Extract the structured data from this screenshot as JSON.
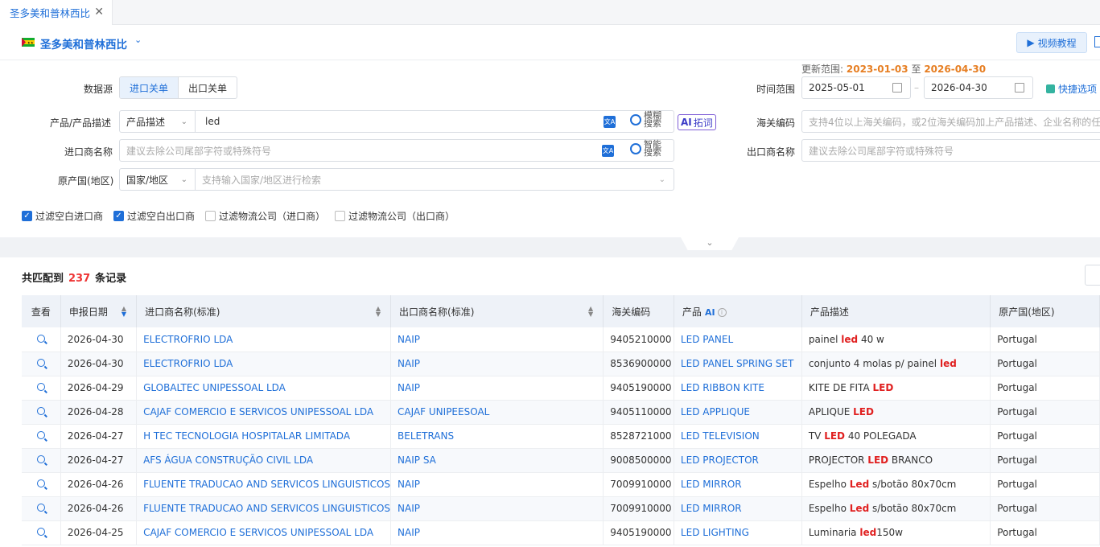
{
  "tabs": [
    {
      "label": "圣多美和普林西比",
      "close": "✕"
    }
  ],
  "header": {
    "country": "圣多美和普林西比",
    "video_btn": "视频教程"
  },
  "update_range": {
    "prefix": "更新范围:",
    "start": "2023-01-03",
    "sep": "至",
    "end": "2026-04-30"
  },
  "form": {
    "datasource_label": "数据源",
    "datasource_options": [
      "进口关单",
      "出口关单"
    ],
    "product_label": "产品/产品描述",
    "product_type": "产品描述",
    "product_value": "led",
    "fuzzy_search": "模糊搜索",
    "ai_expand": "拓词",
    "ai_prefix": "AI",
    "importer_label": "进口商名称",
    "importer_placeholder": "建议去除公司尾部字符或特殊符号",
    "smart_search": "智能搜索",
    "origin_label": "原产国(地区)",
    "origin_type": "国家/地区",
    "origin_placeholder": "支持输入国家/地区进行检索",
    "time_label": "时间范围",
    "time_start": "2025-05-01",
    "time_end": "2026-04-30",
    "time_sep": "–",
    "quick_select": "快捷选项",
    "hs_label": "海关编码",
    "hs_placeholder": "支持4位以上海关编码，或2位海关编码加上产品描述、企业名称的任",
    "exporter_label": "出口商名称",
    "exporter_placeholder": "建议去除公司尾部字符或特殊符号",
    "trans_icon": "文A"
  },
  "filters": [
    {
      "label": "过滤空白进口商",
      "checked": true
    },
    {
      "label": "过滤空白出口商",
      "checked": true
    },
    {
      "label": "过滤物流公司（进口商）",
      "checked": false
    },
    {
      "label": "过滤物流公司（出口商）",
      "checked": false
    }
  ],
  "summary": {
    "prefix": "共匹配到",
    "count": "237",
    "suffix": "条记录"
  },
  "table": {
    "columns": [
      "查看",
      "申报日期",
      "进口商名称(标准)",
      "出口商名称(标准)",
      "海关编码",
      "产品",
      "产品描述",
      "原产国(地区)"
    ],
    "product_ai": "AI",
    "rows": [
      {
        "date": "2026-04-30",
        "importer": "ELECTROFRIO LDA",
        "exporter": "NAIP",
        "hs": "9405210000",
        "product": "LED PANEL",
        "desc_pre": "painel ",
        "desc_kw": "led",
        "desc_post": " 40 w",
        "origin": "Portugal"
      },
      {
        "date": "2026-04-30",
        "importer": "ELECTROFRIO LDA",
        "exporter": "NAIP",
        "hs": "8536900000",
        "product": "LED PANEL SPRING SET",
        "desc_pre": "conjunto 4 molas p/ painel ",
        "desc_kw": "led",
        "desc_post": "",
        "origin": "Portugal"
      },
      {
        "date": "2026-04-29",
        "importer": "GLOBALTEC UNIPESSOAL LDA",
        "exporter": "NAIP",
        "hs": "9405190000",
        "product": "LED RIBBON KITE",
        "desc_pre": "KITE DE FITA ",
        "desc_kw": "LED",
        "desc_post": "",
        "origin": "Portugal"
      },
      {
        "date": "2026-04-28",
        "importer": "CAJAF COMERCIO E SERVICOS UNIPESSOAL LDA",
        "exporter": "CAJAF UNIPEESOAL",
        "hs": "9405110000",
        "product": "LED APPLIQUE",
        "desc_pre": "APLIQUE ",
        "desc_kw": "LED",
        "desc_post": "",
        "origin": "Portugal"
      },
      {
        "date": "2026-04-27",
        "importer": "H TEC TECNOLOGIA HOSPITALAR LIMITADA",
        "exporter": "BELETRANS",
        "hs": "8528721000",
        "product": "LED TELEVISION",
        "desc_pre": "TV ",
        "desc_kw": "LED",
        "desc_post": " 40 POLEGADA",
        "origin": "Portugal"
      },
      {
        "date": "2026-04-27",
        "importer": "AFS ÁGUA CONSTRUÇÃO CIVIL LDA",
        "exporter": "NAIP SA",
        "hs": "9008500000",
        "product": "LED PROJECTOR",
        "desc_pre": "PROJECTOR ",
        "desc_kw": "LED",
        "desc_post": " BRANCO",
        "origin": "Portugal"
      },
      {
        "date": "2026-04-26",
        "importer": "FLUENTE TRADUCAO AND SERVICOS LINGUISTICOS",
        "exporter": "NAIP",
        "hs": "7009910000",
        "product": "LED MIRROR",
        "desc_pre": "Espelho ",
        "desc_kw": "Led",
        "desc_post": " s/botão 80x70cm",
        "origin": "Portugal"
      },
      {
        "date": "2026-04-26",
        "importer": "FLUENTE TRADUCAO AND SERVICOS LINGUISTICOS",
        "exporter": "NAIP",
        "hs": "7009910000",
        "product": "LED MIRROR",
        "desc_pre": "Espelho ",
        "desc_kw": "Led",
        "desc_post": " s/botão 80x70cm",
        "origin": "Portugal"
      },
      {
        "date": "2026-04-25",
        "importer": "CAJAF COMERCIO E SERVICOS UNIPESSOAL LDA",
        "exporter": "NAIP",
        "hs": "9405190000",
        "product": "LED LIGHTING",
        "desc_pre": "Luminaria ",
        "desc_kw": "led",
        "desc_post": "150w",
        "origin": "Portugal"
      }
    ]
  },
  "colors": {
    "accent": "#1f6fd8",
    "highlight": "#e02020",
    "date_highlight": "#e67e22"
  }
}
